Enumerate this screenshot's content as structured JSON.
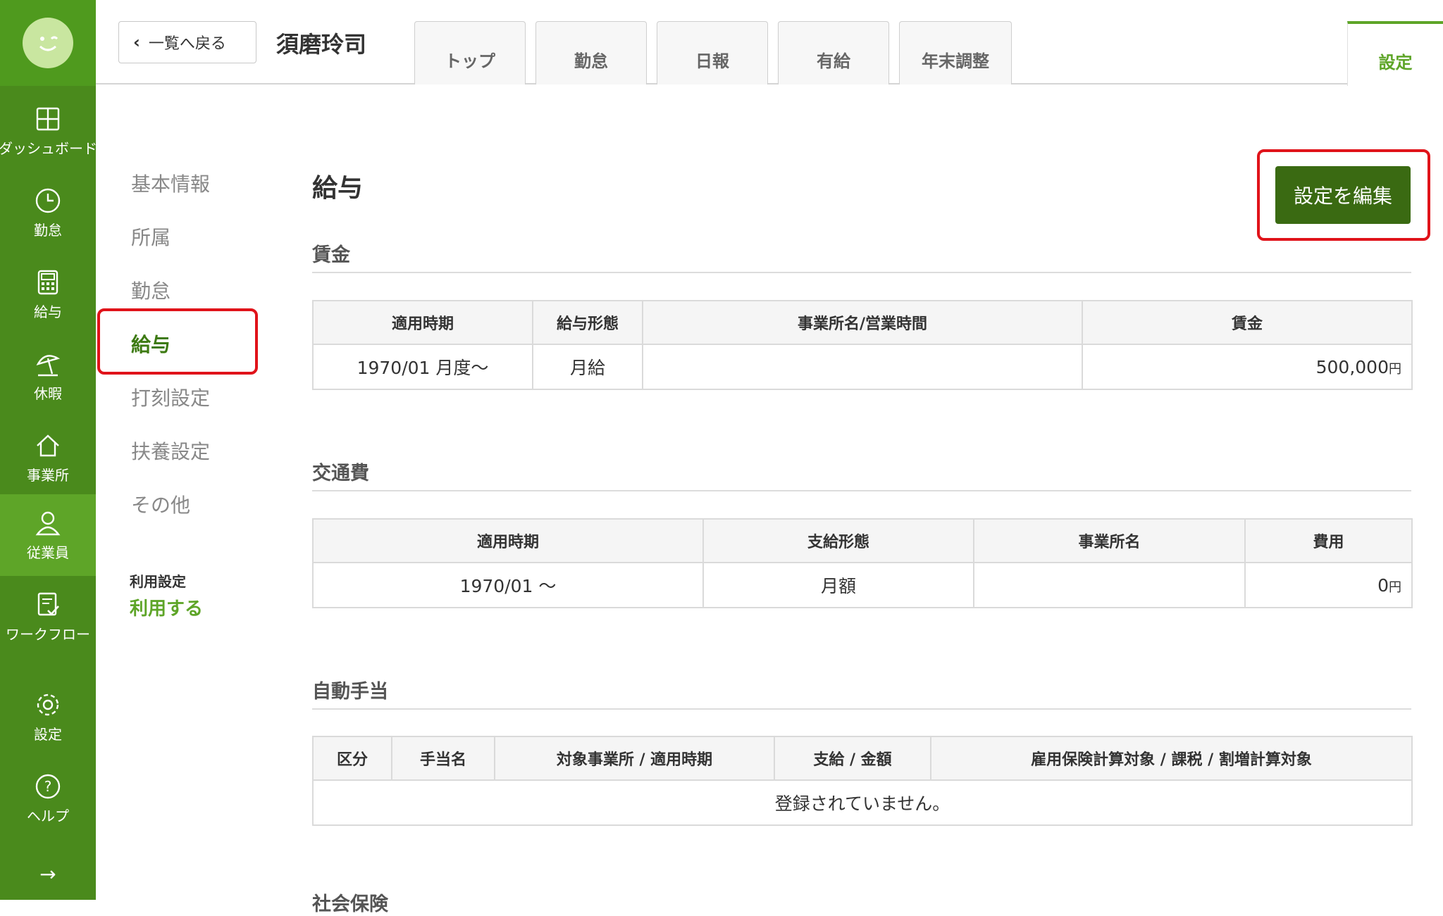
{
  "sidebar": {
    "items": [
      {
        "label": "ダッシュボード",
        "icon": "dashboard-icon"
      },
      {
        "label": "勤怠",
        "icon": "clock-icon"
      },
      {
        "label": "給与",
        "icon": "calculator-icon"
      },
      {
        "label": "休暇",
        "icon": "parasol-icon"
      },
      {
        "label": "事業所",
        "icon": "home-icon"
      },
      {
        "label": "従業員",
        "icon": "person-icon",
        "active": true
      },
      {
        "label": "ワークフロー",
        "icon": "workflow-icon"
      },
      {
        "label": "設定",
        "icon": "gear-icon"
      },
      {
        "label": "ヘルプ",
        "icon": "help-icon"
      }
    ],
    "expand_arrow": "→"
  },
  "header": {
    "back_label": "一覧へ戻る",
    "employee_name": "須磨玲司",
    "tabs": [
      "トップ",
      "勤怠",
      "日報",
      "有給",
      "年末調整"
    ],
    "active_tab": "設定"
  },
  "subnav": {
    "items": [
      "基本情報",
      "所属",
      "勤怠",
      "給与",
      "打刻設定",
      "扶養設定",
      "その他"
    ],
    "active": "給与",
    "usage_label": "利用設定",
    "usage_value": "利用する"
  },
  "main": {
    "title": "給与",
    "edit_button": "設定を編集",
    "wage": {
      "title": "賃金",
      "headers": [
        "適用時期",
        "給与形態",
        "事業所名/営業時間",
        "賃金"
      ],
      "rows": [
        {
          "period": "1970/01 月度〜",
          "type": "月給",
          "office": "",
          "amount": "500,000",
          "unit": "円"
        }
      ]
    },
    "transport": {
      "title": "交通費",
      "headers": [
        "適用時期",
        "支給形態",
        "事業所名",
        "費用"
      ],
      "rows": [
        {
          "period": "1970/01 〜",
          "type": "月額",
          "office": "",
          "amount": "0",
          "unit": "円"
        }
      ]
    },
    "allowance": {
      "title": "自動手当",
      "headers": [
        "区分",
        "手当名",
        "対象事業所 / 適用時期",
        "支給 / 金額",
        "雇用保険計算対象 / 課税 / 割増計算対象"
      ],
      "empty": "登録されていません。"
    },
    "next_section_title": "社会保険"
  },
  "colors": {
    "sidebar": "#4a8a1c",
    "accent": "#5ea528",
    "edit_button": "#3a6a12",
    "highlight": "#e0131a"
  }
}
